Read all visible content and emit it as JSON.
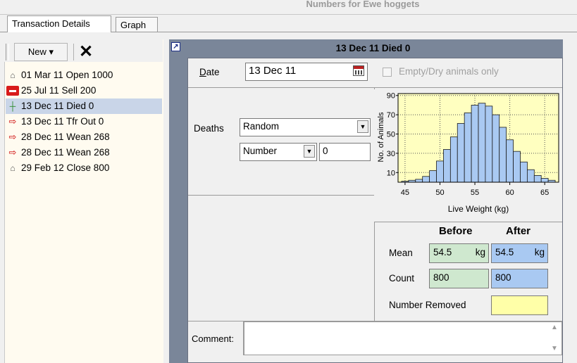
{
  "window": {
    "title": "Numbers for Ewe hoggets"
  },
  "tabs": [
    {
      "label": "Transaction Details"
    },
    {
      "label": "Graph"
    }
  ],
  "toolbar": {
    "new_label": "New",
    "dropdown_glyph": "▾",
    "delete_glyph": "✕"
  },
  "tree": {
    "items": [
      {
        "icon": "sheep-icon",
        "glyph": "⌂",
        "label": "01 Mar 11 Open 1000"
      },
      {
        "icon": "truck-icon",
        "glyph": "▬",
        "label": "25 Jul 11 Sell 200"
      },
      {
        "icon": "died-icon",
        "glyph": "┼",
        "label": "13 Dec 11 Died 0"
      },
      {
        "icon": "transfer-arrow-icon",
        "glyph": "⇨",
        "label": "13 Dec 11 Tfr Out 0"
      },
      {
        "icon": "transfer-arrow-icon",
        "glyph": "⇨",
        "label": "28 Dec 11 Wean 268"
      },
      {
        "icon": "transfer-arrow-icon",
        "glyph": "⇨",
        "label": "28 Dec 11 Wean 268"
      },
      {
        "icon": "sheep-icon",
        "glyph": "⌂",
        "label": "29 Feb 12 Close 800"
      }
    ],
    "selected_index": 2
  },
  "detail": {
    "header_title": "13 Dec 11  Died 0",
    "date_label": "Date",
    "date_value": "13 Dec 11",
    "empty_dry_label": "Empty/Dry animals only",
    "deaths_label": "Deaths",
    "deaths_method": "Random",
    "number_mode": "Number",
    "number_value": "0",
    "comment_label": "Comment:",
    "comment_value": ""
  },
  "stats": {
    "before_label": "Before",
    "after_label": "After",
    "mean_label": "Mean",
    "mean_before": "54.5",
    "mean_after": "54.5",
    "mean_unit": "kg",
    "count_label": "Count",
    "count_before": "800",
    "count_after": "800",
    "removed_label": "Number Removed",
    "removed_value": ""
  },
  "colors": {
    "hist_fill": "#a9c9f2",
    "chart_bg": "#ffffc0",
    "box_before": "#cfe8cf",
    "box_after": "#a9c9f2",
    "box_removed": "#ffffa8",
    "header_bar": "#7a8699"
  },
  "chart_data": {
    "type": "bar",
    "xlabel": "Live Weight (kg)",
    "ylabel": "No. of Animals",
    "x_ticks": [
      "45",
      "50",
      "55",
      "60",
      "65"
    ],
    "y_ticks": [
      "10",
      "30",
      "50",
      "70",
      "90"
    ],
    "xlim": [
      44,
      67
    ],
    "ylim": [
      0,
      92
    ],
    "grid": true,
    "bin_width": 1,
    "x": [
      45,
      46,
      47,
      48,
      49,
      50,
      51,
      52,
      53,
      54,
      55,
      56,
      57,
      58,
      59,
      60,
      61,
      62,
      63,
      64,
      65,
      66
    ],
    "values": [
      1,
      2,
      3,
      6,
      12,
      22,
      34,
      47,
      61,
      72,
      80,
      82,
      79,
      70,
      57,
      44,
      32,
      21,
      13,
      7,
      4,
      2
    ]
  }
}
